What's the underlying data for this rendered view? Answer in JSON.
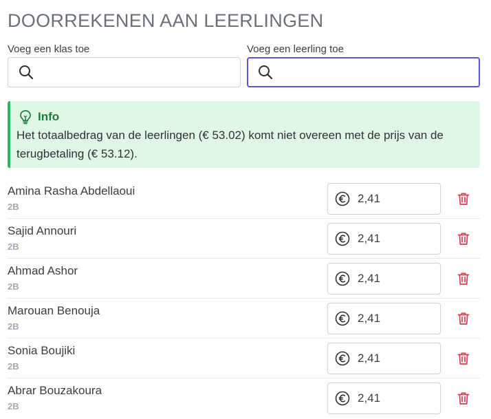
{
  "page": {
    "title": "DOORREKENEN AAN LEERLINGEN"
  },
  "search": {
    "class_label": "Voeg een klas toe",
    "class_value": "",
    "student_label": "Voeg een leerling toe",
    "student_value": ""
  },
  "info": {
    "title": "Info",
    "message": "Het totaalbedrag van de leerlingen (€ 53.02) komt niet overeen met de prijs van de terugbetaling (€ 53.12).",
    "color": "#2fb45c"
  },
  "students": [
    {
      "name": "Amina Rasha Abdellaoui",
      "class": "2B",
      "amount": "2,41"
    },
    {
      "name": "Sajid Annouri",
      "class": "2B",
      "amount": "2,41"
    },
    {
      "name": "Ahmad Ashor",
      "class": "2B",
      "amount": "2,41"
    },
    {
      "name": "Marouan Benouja",
      "class": "2B",
      "amount": "2,41"
    },
    {
      "name": "Sonia Boujiki",
      "class": "2B",
      "amount": "2,41"
    },
    {
      "name": "Abrar Bouzakoura",
      "class": "2B",
      "amount": "2,41"
    }
  ],
  "icons": {
    "search": "search-icon",
    "info": "lightbulb-icon",
    "currency": "euro-icon",
    "delete": "trash-icon"
  },
  "colors": {
    "focus": "#5b55d6",
    "delete": "#e0394f",
    "info_bg": "#e0f7e6"
  }
}
